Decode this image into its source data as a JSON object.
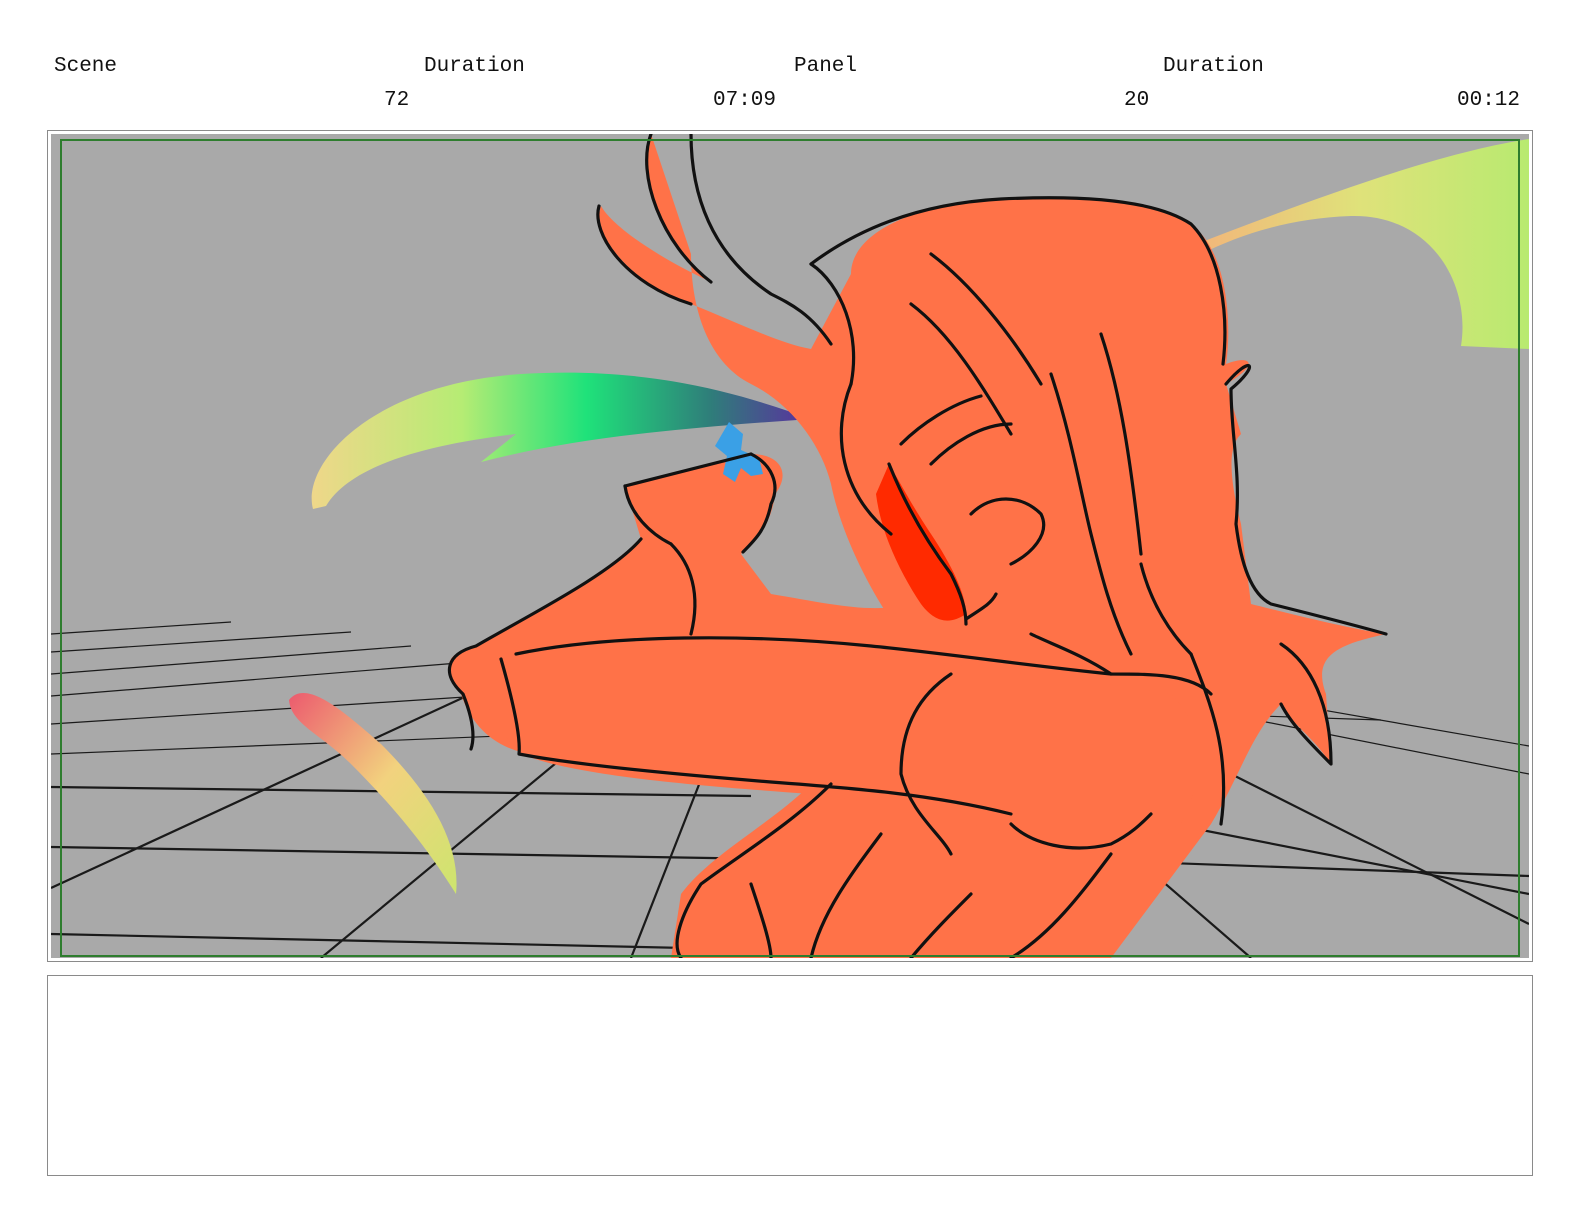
{
  "header": {
    "scene_label": "Scene",
    "scene_duration_label": "Duration",
    "panel_label": "Panel",
    "panel_duration_label": "Duration",
    "scene_value": "72",
    "scene_duration_value": "07:09",
    "panel_value": "20",
    "panel_duration_value": "00:12"
  },
  "panel_image": {
    "colors": {
      "background": "#a9a9a9",
      "figure": "#ff7248",
      "accent_red": "#ff2a00",
      "object_blue": "#3aa0e6",
      "safe_frame": "#2e7d2e"
    }
  },
  "notes": {
    "text": ""
  }
}
